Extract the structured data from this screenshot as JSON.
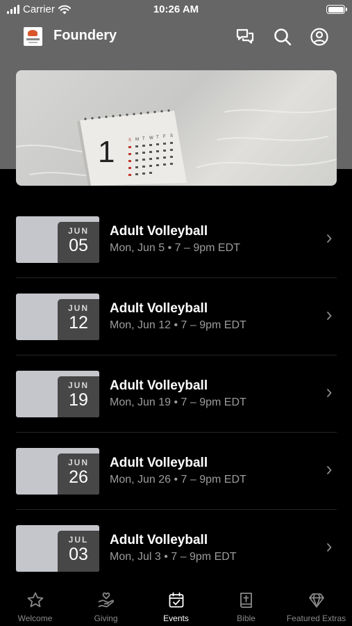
{
  "status_bar": {
    "carrier": "Carrier",
    "time": "10:26 AM"
  },
  "app": {
    "title": "Foundery"
  },
  "header_icons": [
    "chat-bubbles-icon",
    "search-icon",
    "account-icon"
  ],
  "hero": {
    "image": "desk-calendar-photo",
    "calendar_day": "1"
  },
  "events": [
    {
      "month": "JUN",
      "day": "05",
      "title": "Adult Volleyball",
      "subtitle": "Mon, Jun 5 • 7 – 9pm EDT"
    },
    {
      "month": "JUN",
      "day": "12",
      "title": "Adult Volleyball",
      "subtitle": "Mon, Jun 12 • 7 – 9pm EDT"
    },
    {
      "month": "JUN",
      "day": "19",
      "title": "Adult Volleyball",
      "subtitle": "Mon, Jun 19 • 7 – 9pm EDT"
    },
    {
      "month": "JUN",
      "day": "26",
      "title": "Adult Volleyball",
      "subtitle": "Mon, Jun 26 • 7 – 9pm EDT"
    },
    {
      "month": "JUL",
      "day": "03",
      "title": "Adult Volleyball",
      "subtitle": "Mon, Jul 3 • 7 – 9pm EDT"
    }
  ],
  "tabs": [
    {
      "label": "Welcome",
      "icon": "star-icon",
      "active": false
    },
    {
      "label": "Giving",
      "icon": "giving-hand-icon",
      "active": false
    },
    {
      "label": "Events",
      "icon": "calendar-check-icon",
      "active": true
    },
    {
      "label": "Bible",
      "icon": "bible-icon",
      "active": false
    },
    {
      "label": "Featured Extras",
      "icon": "diamond-icon",
      "active": false
    }
  ],
  "colors": {
    "header_bg": "#666666",
    "background": "#000000",
    "badge_bg": "#474747",
    "thumb_bg": "#c4c6cb",
    "inactive_tab": "#8a8a8a"
  }
}
